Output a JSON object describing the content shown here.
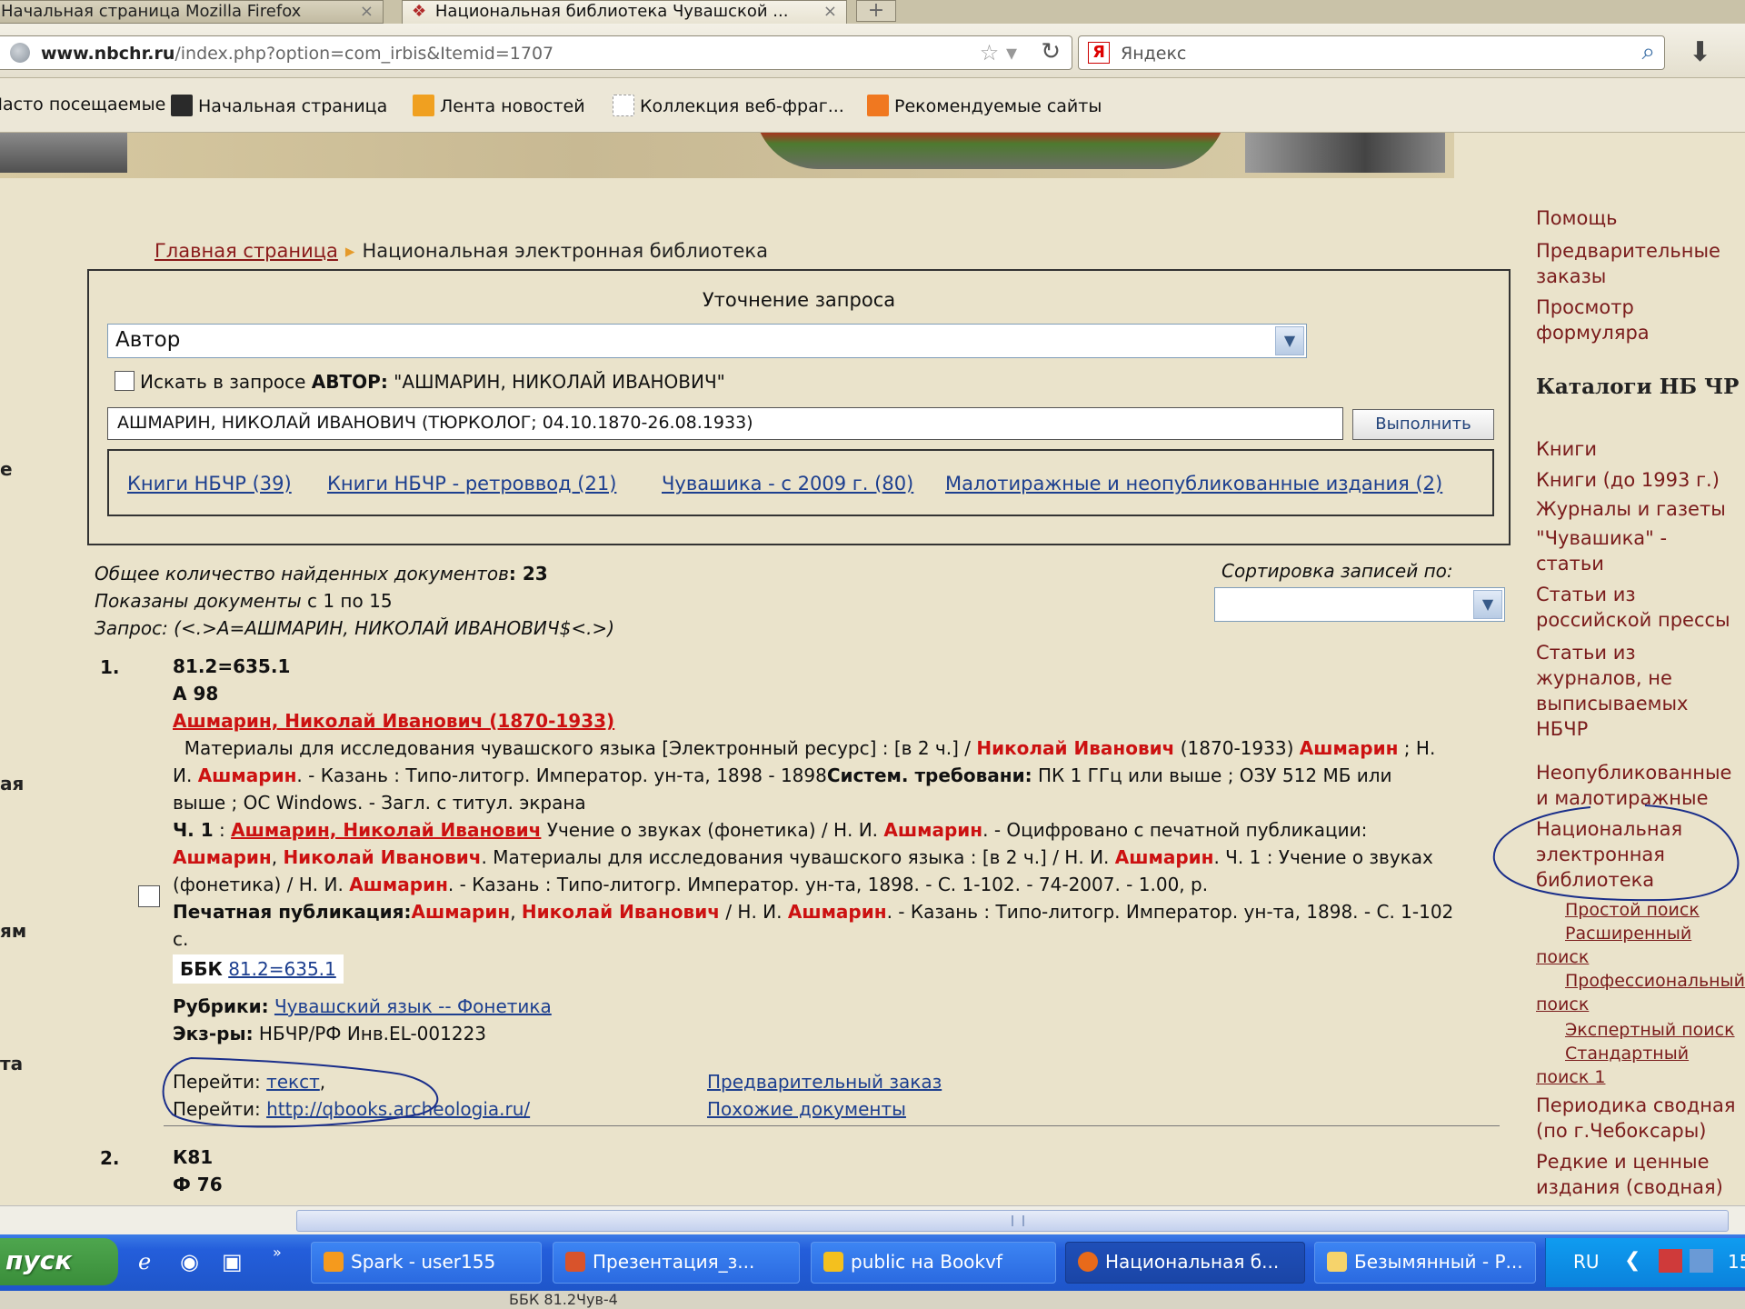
{
  "browser": {
    "tabs": [
      {
        "label": "Начальная страница Mozilla Firefox",
        "close": "×"
      },
      {
        "label": "Национальная библиотека Чувашской ...",
        "close": "×"
      }
    ],
    "newtab": "+",
    "url_domain": "www.nbchr.ru",
    "url_path": "/index.php?option=com_irbis&Itemid=1707",
    "search_engine": "Яндекс",
    "search_placeholder": "Яндекс",
    "bookmarks": [
      "Часто посещаемые",
      "Начальная страница",
      "Лента новостей",
      "Коллекция веб-фраг...",
      "Рекомендуемые сайты"
    ]
  },
  "left_edge": [
    "е",
    "ая",
    "ям",
    "та"
  ],
  "breadcrumb": {
    "home": "Главная страница",
    "current": "Национальная электронная библиотека"
  },
  "refine": {
    "title": "Уточнение запроса",
    "field_value": "Автор",
    "checkbox_prefix": "Искать в запросе ",
    "checkbox_field": "АВТОР:",
    "checkbox_value": " \"АШМАРИН, НИКОЛАЙ ИВАНОВИЧ\"",
    "query_value": "АШМАРИН, НИКОЛАЙ ИВАНОВИЧ (ТЮРКОЛОГ; 04.10.1870-26.08.1933)",
    "execute_label": "Выполнить",
    "databases": [
      "Книги НБЧР (39)",
      "Книги НБЧР - ретроввод (21)",
      "Чувашика - с 2009 г. (80)",
      "Малотиражные и неопубликованные издания (2)"
    ]
  },
  "results": {
    "total_label": "Общее количество найденных документов",
    "total_value": ": 23",
    "shown_label": "Показаны документы",
    "shown_value": " с 1 по 15",
    "query_line": "Запрос: (<.>A=АШМАРИН, НИКОЛАЙ ИВАНОВИЧ$<.>)",
    "sort_label": "Сортировка записей по:",
    "sort_value": ""
  },
  "record1": {
    "num": "1.",
    "code1": "81.2=635.1",
    "code2": "А 98",
    "author": "Ашмарин, Николай Иванович (1870-1933)",
    "l1a": "Материалы для исследования чувашского языка [Электронный ресурс] : [в 2 ч.] / ",
    "l1b": "Николай Иванович",
    "l1c": " (1870-1933) ",
    "l1d": "Ашмарин",
    "l1e": " ; Н.",
    "l2a": "И. ",
    "l2b": "Ашмарин",
    "l2c": ". - Казань : Типо-литогр. Император. ун-та, 1898 - 1898",
    "l2d": "Систем. требовани:",
    "l2e": " ПК 1 ГГц или выше ; ОЗУ 512 МБ или",
    "l3": "выше ; ОС Windows. - Загл. с титул. экрана",
    "l4a": "Ч. 1",
    "l4b": " : ",
    "l4c": "Ашмарин, Николай Иванович",
    "l4d": " Учение о звуках (фонетика) / Н. И. ",
    "l4e": "Ашмарин",
    "l4f": ". - Оцифровано с печатной публикации:",
    "l5a": "Ашмарин",
    "l5b": ", ",
    "l5c": "Николай Иванович",
    "l5d": ". Материалы для исследования чувашского языка : [в 2 ч.] / Н. И. ",
    "l5e": "Ашмарин",
    "l5f": ". Ч. 1 : Учение о звуках",
    "l6a": "(фонетика) / Н. И. ",
    "l6b": "Ашмарин",
    "l6c": ". - Казань : Типо-литогр. Император. ун-та, 1898. - С. 1-102. - 74-2007. - 1.00, р.",
    "l7a": "Печатная публикация:",
    "l7b": "Ашмарин",
    "l7c": ", ",
    "l7d": "Николай Иванович",
    "l7e": " / Н. И. ",
    "l7f": "Ашмарин",
    "l7g": ". - Казань : Типо-литогр. Император. ун-та, 1898. - С. 1-102",
    "l8": "с.",
    "bbk_label": "ББК",
    "bbk_value": "81.2=635.1",
    "rubric_label": "Рубрики:",
    "rubric_value": "Чувашский язык -- Фонетика",
    "copies_label": "Экз-ры:",
    "copies_value": " НБЧР/РФ Инв.EL-001223",
    "goto_label": "Перейти: ",
    "goto_text": "текст",
    "goto_text_sep": ",",
    "goto_url": "http://qbooks.archeologia.ru/",
    "preorder": "Предварительный заказ",
    "similar": "Похожие документы"
  },
  "record2": {
    "num": "2.",
    "code1": "К81",
    "code2": "Ф 76"
  },
  "sidebar": {
    "help": "Помощь",
    "preorders_1": "Предварительные",
    "preorders_2": "заказы",
    "formular_1": "Просмотр",
    "formular_2": "формуляра",
    "catalogs_heading": "Каталоги НБ ЧР",
    "items": [
      "Книги",
      "Книги (до 1993 г.)",
      "Журналы и газеты",
      "\"Чувашика\" -",
      "статьи",
      "Статьи из",
      "российской прессы",
      "Статьи из",
      "журналов, не",
      "выписываемых",
      "НБЧР",
      "Неопубликованные",
      "и малотиражные",
      "Национальная",
      "электронная",
      "библиотека"
    ],
    "sub": [
      "Простой поиск",
      "Расширенный",
      "поиск",
      "Профессиональный",
      "поиск",
      "Экспертный поиск",
      "Стандартный",
      "поиск 1"
    ],
    "tail": [
      "Периодика сводная",
      "(по г.Чебоксары)",
      "Редкие и ценные",
      "издания (сводная)"
    ]
  },
  "taskbar": {
    "start": "пуск",
    "items": [
      "Spark - user155",
      "Презентация_з...",
      "public на Bookvf",
      "Национальная б...",
      "Безымянный - Р..."
    ],
    "lang": "RU",
    "clock": "15",
    "bottom_text": "ББК 81.2Чув-4"
  }
}
